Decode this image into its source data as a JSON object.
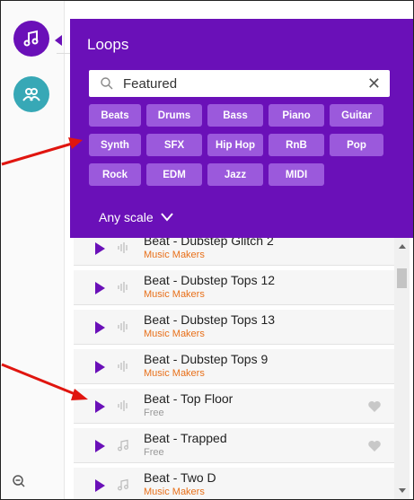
{
  "panel": {
    "title": "Loops",
    "search_value": "Featured",
    "clear_symbol": "✕",
    "scale_label": "Any scale"
  },
  "chips": [
    [
      "Beats",
      "Drums",
      "Bass",
      "Piano",
      "Guitar"
    ],
    [
      "Synth",
      "SFX",
      "Hip Hop",
      "RnB",
      "Pop"
    ],
    [
      "Rock",
      "EDM",
      "Jazz",
      "MIDI"
    ]
  ],
  "loops": [
    {
      "title": "Beat - Dubstep Glitch 2",
      "subtitle": "Music Makers",
      "type": "maker",
      "icon": "waveform-icon",
      "heart": false
    },
    {
      "title": "Beat - Dubstep Tops 12",
      "subtitle": "Music Makers",
      "type": "maker",
      "icon": "waveform-icon",
      "heart": false
    },
    {
      "title": "Beat - Dubstep Tops 13",
      "subtitle": "Music Makers",
      "type": "maker",
      "icon": "waveform-icon",
      "heart": false
    },
    {
      "title": "Beat - Dubstep Tops 9",
      "subtitle": "Music Makers",
      "type": "maker",
      "icon": "waveform-icon",
      "heart": false
    },
    {
      "title": "Beat - Top Floor",
      "subtitle": "Free",
      "type": "free",
      "icon": "waveform-icon",
      "heart": true
    },
    {
      "title": "Beat - Trapped",
      "subtitle": "Free",
      "type": "free",
      "icon": "music-note-icon",
      "heart": true
    },
    {
      "title": "Beat - Two D",
      "subtitle": "Music Makers",
      "type": "maker",
      "icon": "music-note-icon",
      "heart": false
    }
  ],
  "colors": {
    "accent": "#6a10b8",
    "chip": "#9b59dc",
    "maker": "#e8701a",
    "teal": "#37a8b6",
    "annotation": "#e0150f"
  }
}
